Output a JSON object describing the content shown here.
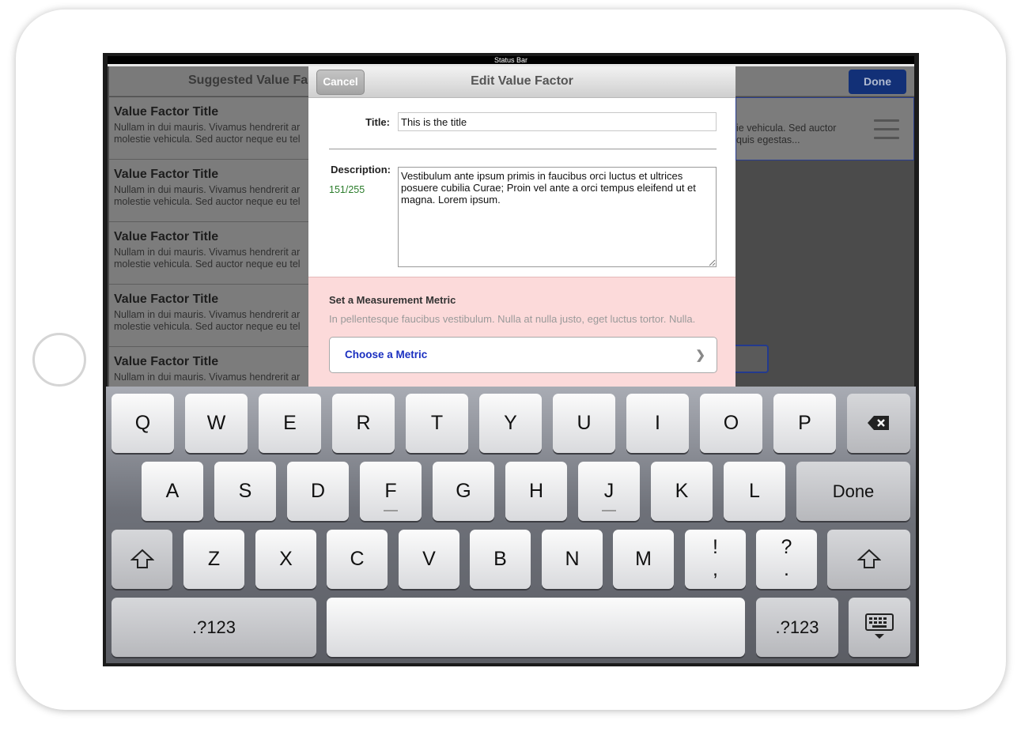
{
  "status_bar": {
    "text": "Status Bar"
  },
  "background": {
    "left_nav_title": "Suggested Value Fa",
    "done_label": "Done",
    "list_items": [
      {
        "title": "Value Factor Title",
        "line1": "Nullam in dui mauris. Vivamus hendrerit ar",
        "line2": "molestie vehicula. Sed auctor neque eu tel"
      },
      {
        "title": "Value Factor Title",
        "line1": "Nullam in dui mauris. Vivamus hendrerit ar",
        "line2": "molestie vehicula. Sed auctor neque eu tel"
      },
      {
        "title": "Value Factor Title",
        "line1": "Nullam in dui mauris. Vivamus hendrerit ar",
        "line2": "molestie vehicula. Sed auctor neque eu tel"
      },
      {
        "title": "Value Factor Title",
        "line1": "Nullam in dui mauris. Vivamus hendrerit ar",
        "line2": "molestie vehicula. Sed auctor neque eu tel"
      },
      {
        "title": "Value Factor Title",
        "line1": "Nullam in dui mauris. Vivamus hendrerit ar",
        "line2": ""
      }
    ],
    "right_card": {
      "line1": "ie vehicula. Sed auctor",
      "line2": "quis egestas..."
    }
  },
  "modal": {
    "cancel_label": "Cancel",
    "title": "Edit Value Factor",
    "title_label": "Title:",
    "title_value": "This is the title",
    "description_label": "Description:",
    "char_counter": "151/255",
    "description_value": "Vestibulum ante ipsum primis in faucibus orci luctus et ultrices posuere cubilia Curae; Proin vel ante a orci tempus eleifend ut et magna. Lorem ipsum.",
    "metric": {
      "heading": "Set a Measurement Metric",
      "help": "In pellentesque faucibus vestibulum. Nulla at nulla justo, eget luctus tortor. Nulla.",
      "choose_label": "Choose a Metric",
      "chevron": "❯"
    }
  },
  "keyboard": {
    "row1": [
      "Q",
      "W",
      "E",
      "R",
      "T",
      "Y",
      "U",
      "I",
      "O",
      "P"
    ],
    "backspace_icon": "backspace-icon",
    "row2": [
      "A",
      "S",
      "D",
      "F",
      "G",
      "H",
      "J",
      "K",
      "L"
    ],
    "done_label": "Done",
    "shift_glyph": "⇧",
    "row3": [
      "Z",
      "X",
      "C",
      "V",
      "B",
      "N",
      "M"
    ],
    "punct1": {
      "top": "!",
      "bottom": ","
    },
    "punct2": {
      "top": "?",
      "bottom": "."
    },
    "numbers_label": ".?123",
    "hide_keyboard_icon": "keyboard-hide-icon"
  },
  "colors": {
    "done_nav": "#123077",
    "metric_bg": "#fcdada",
    "metric_link": "#1a2fc0",
    "counter": "#2c7d2c"
  }
}
